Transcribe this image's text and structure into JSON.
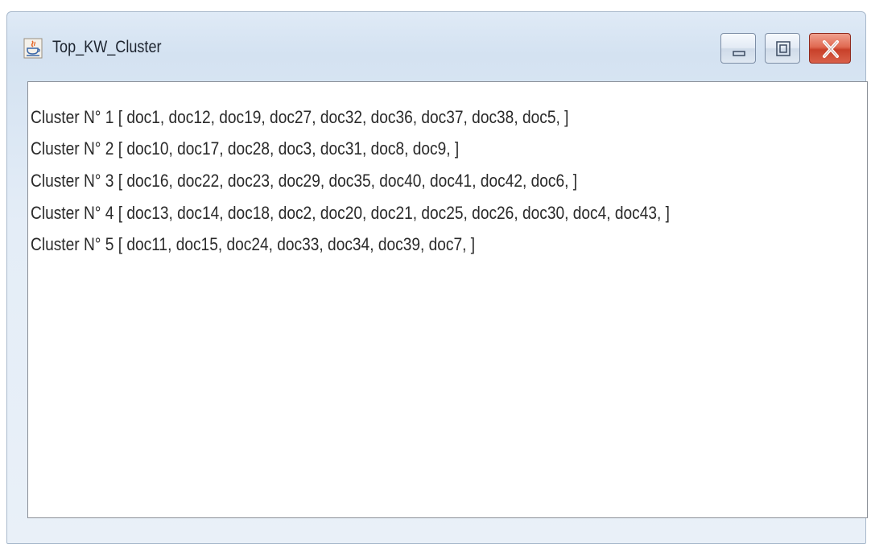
{
  "window": {
    "title": "Top_KW_Cluster",
    "app_icon": "java-cup-icon",
    "controls": [
      "minimize-icon",
      "maximize-icon",
      "close-icon"
    ],
    "close_button_color": "#d9553d"
  },
  "clusters": [
    {
      "text": " Cluster N° 1  [ doc1,  doc12,  doc19,  doc27,  doc32,  doc36,  doc37,  doc38,  doc5, ]"
    },
    {
      "text": "Cluster N° 2  [ doc10,  doc17,  doc28,  doc3,  doc31,  doc8,  doc9, ]"
    },
    {
      "text": "Cluster N° 3  [ doc16,  doc22,  doc23,  doc29,  doc35,  doc40,  doc41,  doc42,  doc6, ]"
    },
    {
      "text": "Cluster N° 4  [ doc13,  doc14,  doc18,  doc2,  doc20,  doc21,  doc25,  doc26,  doc30,  doc4,  doc43, ]"
    },
    {
      "text": "Cluster N° 5  [ doc11,  doc15,  doc24,  doc33,  doc34,  doc39,  doc7, ]"
    }
  ]
}
